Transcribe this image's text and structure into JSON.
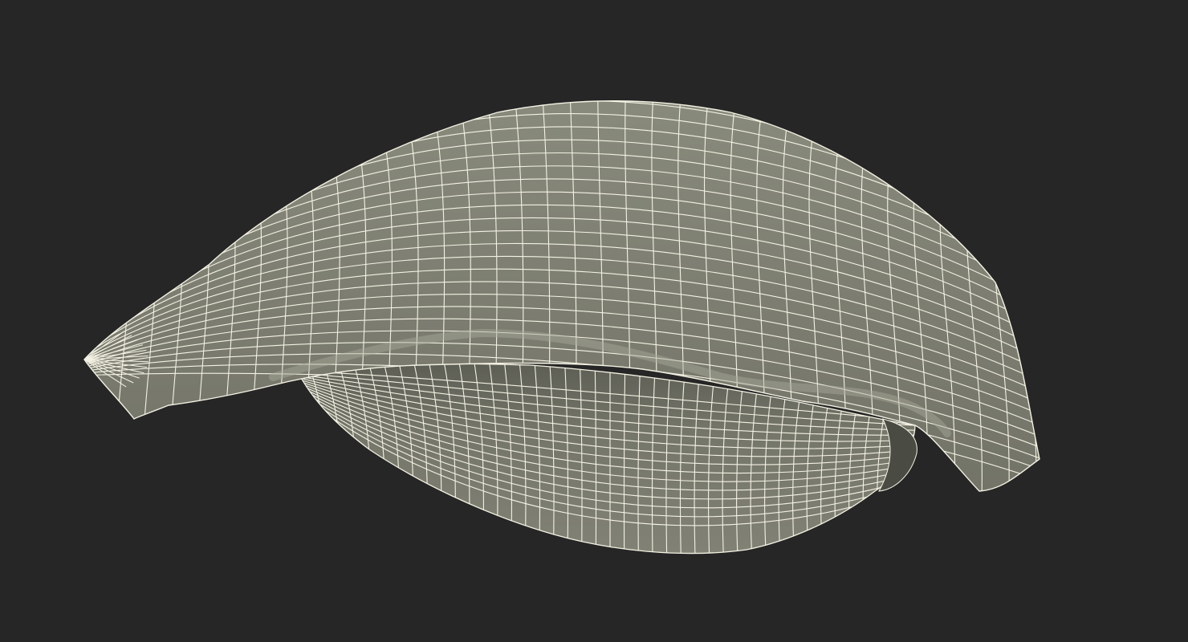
{
  "scene": {
    "background_color": "#262626",
    "mesh_fill_color": "#7b7c6f",
    "mesh_shadow_color": "#5e5f55",
    "mesh_highlight_color": "#9c9d90",
    "wireframe_color": "#f4f2e4",
    "render_mode": "wireframe-on-shaded",
    "subject": "shell-mesh"
  }
}
